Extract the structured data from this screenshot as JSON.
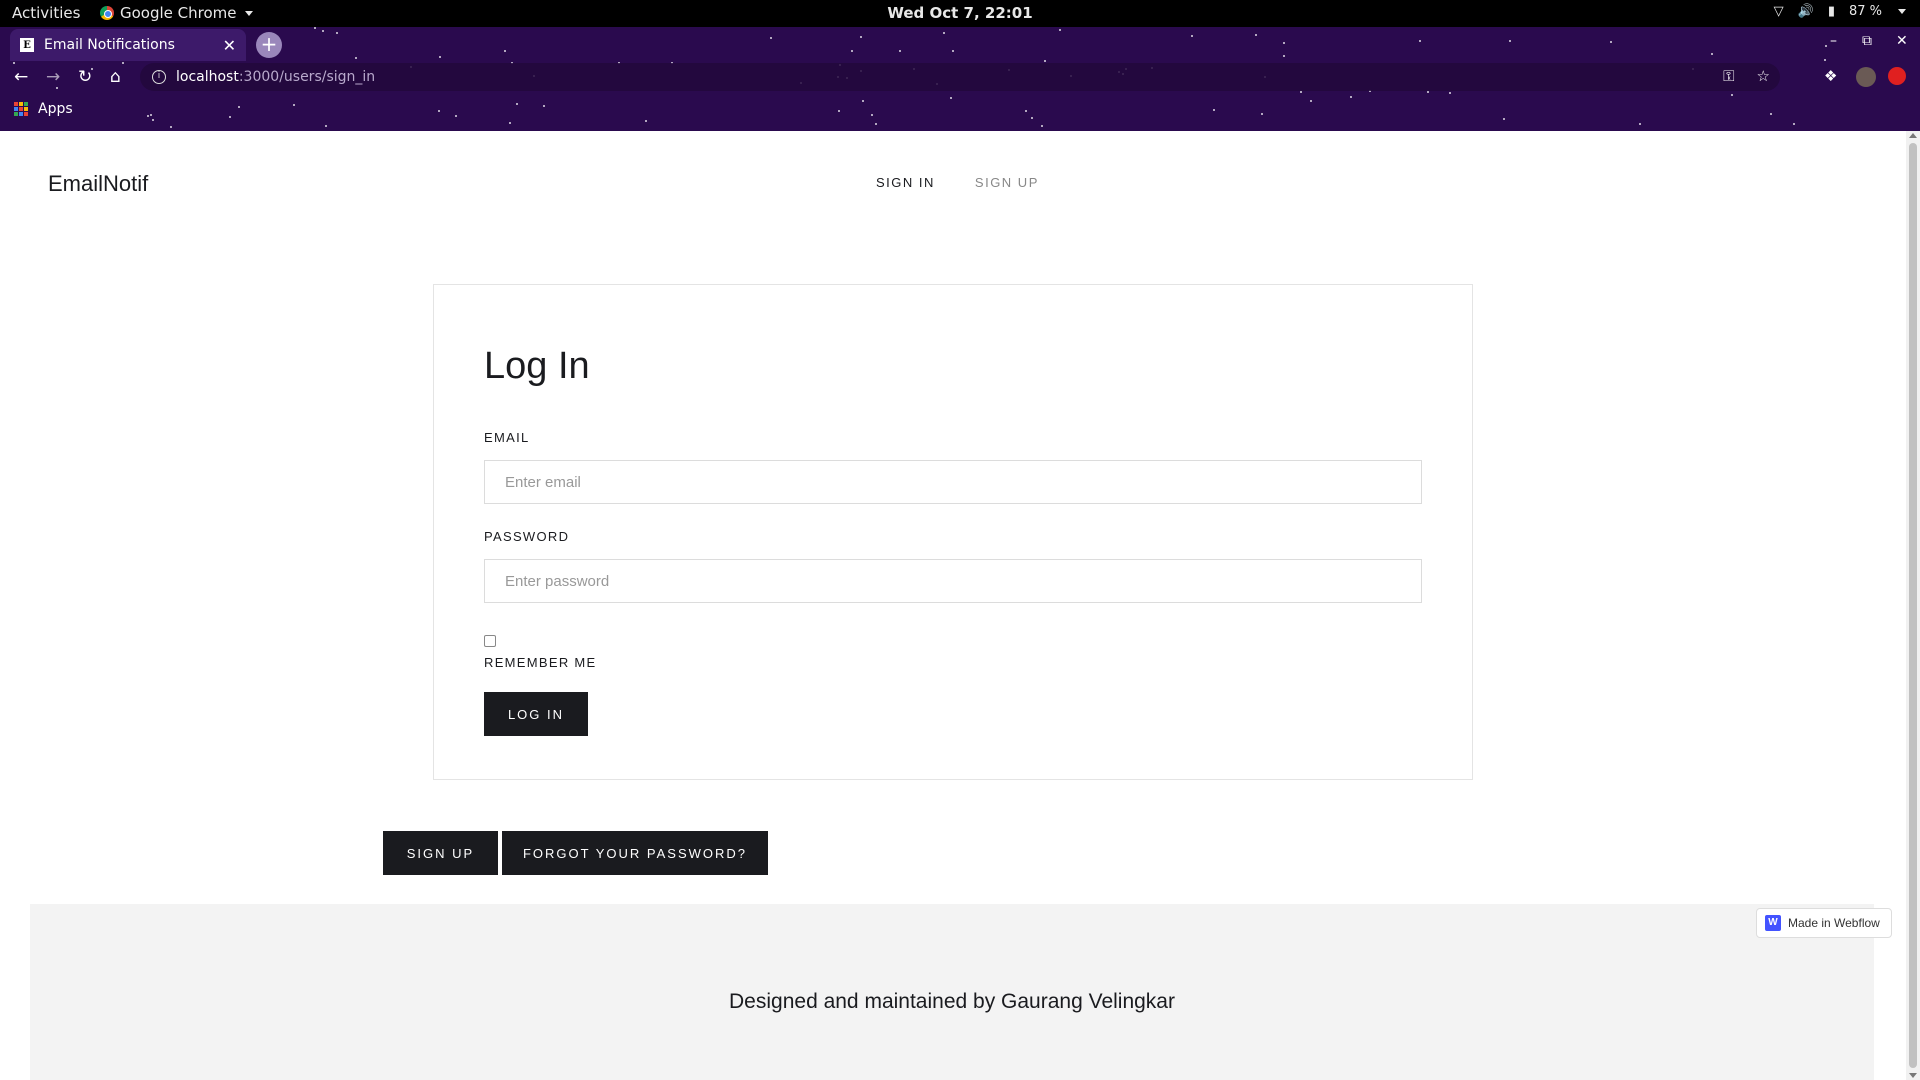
{
  "system": {
    "activities": "Activities",
    "app_name": "Google Chrome",
    "clock": "Wed Oct  7, 22:01",
    "battery": "87 %"
  },
  "browser": {
    "tab_title": "Email Notifications",
    "tab_favicon": "E",
    "url_host": "localhost",
    "url_path": ":3000/users/sign_in",
    "bookmarks_apps": "Apps"
  },
  "site": {
    "brand": "EmailNotif",
    "nav": {
      "sign_in": "SIGN IN",
      "sign_up": "SIGN UP"
    }
  },
  "login": {
    "title": "Log In",
    "email_label": "EMAIL",
    "email_placeholder": "Enter email",
    "password_label": "PASSWORD",
    "password_placeholder": "Enter password",
    "remember_label": "REMEMBER ME",
    "login_button": "LOG IN"
  },
  "links": {
    "sign_up": "SIGN UP",
    "forgot": "FORGOT YOUR PASSWORD?"
  },
  "footer": {
    "credit": "Designed and maintained by Gaurang Velingkar",
    "badge": "Made in Webflow"
  }
}
